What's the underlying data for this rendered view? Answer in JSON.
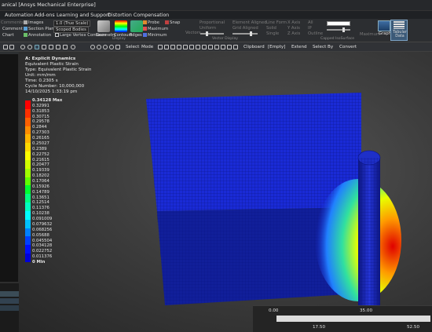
{
  "window": {
    "title": "anical [Ansys Mechanical Enterprise]"
  },
  "tabs": [
    "Automation",
    "Add-ons",
    "Learning and Support",
    "Distortion Compensation"
  ],
  "ribbon": {
    "col1": [
      "Comments",
      "Comment",
      "Chart"
    ],
    "images_label": "Images",
    "section_plane_label": "Section Plane",
    "annotation_label": "Annotation",
    "scale_value": "1.0 (True Scale)",
    "scoped_bodies_value": "Scoped Bodies",
    "large_vertex_label": "Large Vertex Contours",
    "geometry_label": "Geometry",
    "contours_label": "Contours",
    "edges_label": "Edges",
    "display_group": "Display",
    "probe_label": "Probe",
    "maximum_label": "Maximum",
    "minimum_label": "Minimum",
    "snap_label": "Snap",
    "proportional_label": "Proportional",
    "uniform_label": "Uniform",
    "vectors_label": "Vectors",
    "element_aligned_label": "Element Aligned",
    "grid_aligned_label": "Grid Aligned",
    "vector_display_group": "Vector Display",
    "line_form_label": "Line Form",
    "solid_label": "Solid",
    "single_label": "Single",
    "x_axis": "X Axis",
    "y_axis": "Y Axis",
    "z_axis": "Z Axis",
    "all_label": "All",
    "ip_label": "IP",
    "outline_label": "Outline",
    "capped_group": "Capped IsoSurface",
    "maximum_right": "Maximum",
    "graph_label": "Graph",
    "tabular_label": "Tabular Data"
  },
  "toolbar": {
    "select": "Select",
    "mode": "Mode",
    "clipboard": "Clipboard",
    "empty": "[Empty]",
    "extend": "Extend",
    "select_by": "Select By",
    "convert": "Convert"
  },
  "result": {
    "analysis": "A: Explicit Dynamics",
    "name": "Equivalent Plastic Strain",
    "type": "Type: Equivalent Plastic Strain",
    "unit": "Unit: mm/mm",
    "time": "Time: 0.2305 s",
    "cycle": "Cycle Number: 10,000,000",
    "date": "14/10/2025 1:33:19 pm"
  },
  "legend": {
    "max": "0.34128 Max",
    "values": [
      "0.32991",
      "0.31853",
      "0.30715",
      "0.29578",
      "0.2844",
      "0.27303",
      "0.26165",
      "0.25027",
      "0.2389",
      "0.22752",
      "0.21615",
      "0.20477",
      "0.19339",
      "0.18202",
      "0.17064",
      "0.15926",
      "0.14789",
      "0.13651",
      "0.12514",
      "0.11376",
      "0.10238",
      "0.091009",
      "0.079632",
      "0.068256",
      "0.05688",
      "0.045504",
      "0.034128",
      "0.022752",
      "0.011376"
    ],
    "min": "0 Min",
    "colors": [
      "#ff0000",
      "#ff3000",
      "#ff6000",
      "#ff8c00",
      "#ffb400",
      "#ffd800",
      "#ffff00",
      "#d0ff00",
      "#a0ff00",
      "#60ff00",
      "#00ff30",
      "#00ff80",
      "#00ffc0",
      "#00ffff",
      "#00c0ff",
      "#0080ff",
      "#0040ff",
      "#0010ff",
      "#0000d8"
    ]
  },
  "timeline": {
    "t0": "0.00",
    "t35": "35.00",
    "t17": "17.50",
    "t52": "52.50"
  },
  "colors": {
    "plate_blue": "#1a2bd6",
    "plate_dark": "#111f9a",
    "roller_blue": "#1e2fc8"
  }
}
